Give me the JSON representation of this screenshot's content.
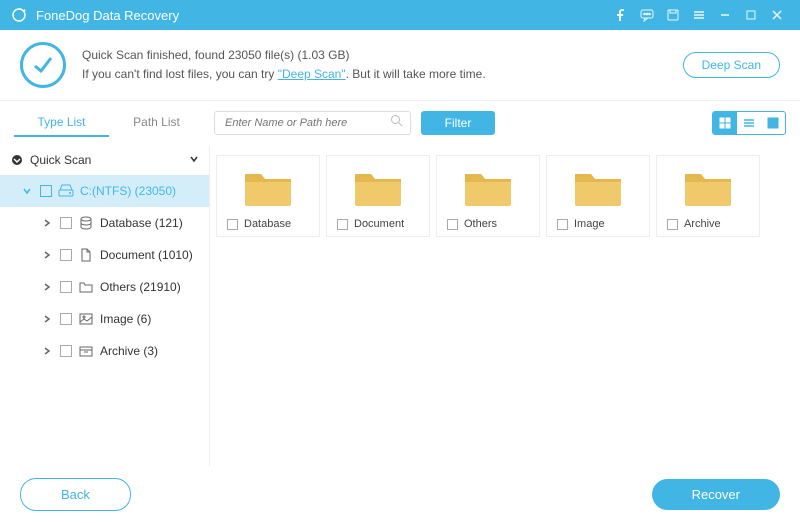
{
  "app": {
    "title": "FoneDog Data Recovery"
  },
  "banner": {
    "line1": "Quick Scan finished, found 23050 file(s) (1.03 GB)",
    "line2a": "If you can't find lost files, you can try ",
    "link": "\"Deep Scan\"",
    "line2b": ". But it will take more time.",
    "deep_scan": "Deep Scan"
  },
  "tabs": {
    "type": "Type List",
    "path": "Path List"
  },
  "search": {
    "placeholder": "Enter Name or Path here"
  },
  "filter": "Filter",
  "tree": {
    "root": "Quick Scan",
    "drive": "C:(NTFS) (23050)",
    "items": [
      {
        "label": "Database (121)"
      },
      {
        "label": "Document (1010)"
      },
      {
        "label": "Others (21910)"
      },
      {
        "label": "Image (6)"
      },
      {
        "label": "Archive (3)"
      }
    ]
  },
  "folders": [
    {
      "label": "Database"
    },
    {
      "label": "Document"
    },
    {
      "label": "Others"
    },
    {
      "label": "Image"
    },
    {
      "label": "Archive"
    }
  ],
  "footer": {
    "back": "Back",
    "recover": "Recover"
  }
}
